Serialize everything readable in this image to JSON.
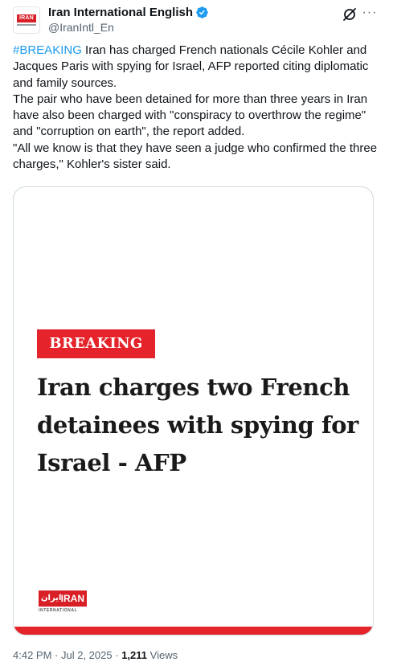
{
  "author": {
    "display_name": "Iran International English",
    "handle": "@IranIntl_En",
    "verified": true
  },
  "tweet": {
    "hashtag": "#BREAKING",
    "line1_rest": " Iran has charged French nationals Cécile Kohler and Jacques Paris with spying for Israel, AFP reported citing diplomatic and family sources.",
    "paragraph2": "The pair who have been detained for more than three years in Iran have also been charged with \"conspiracy to overthrow the regime\" and \"corruption on earth\", the report added.",
    "paragraph3": "\"All we know is that they have seen a judge who confirmed the three charges,\" Kohler's sister said."
  },
  "media": {
    "badge": "BREAKING",
    "headline": "Iran charges two French detainees with spying for Israel - AFP",
    "logo_text": "IRAN",
    "logo_farsi": "ایران",
    "logo_subtext": "INTERNATIONAL"
  },
  "meta": {
    "time": "4:42 PM",
    "date": "Jul 2, 2025",
    "views_count": "1,211",
    "views_label": "Views"
  },
  "icons": {
    "verified": "verified-badge-icon",
    "grok": "grok-icon",
    "more": "more-options-icon"
  },
  "colors": {
    "link": "#1d9bf0",
    "breaking_red": "#e4232a",
    "secondary_text": "#536471"
  }
}
